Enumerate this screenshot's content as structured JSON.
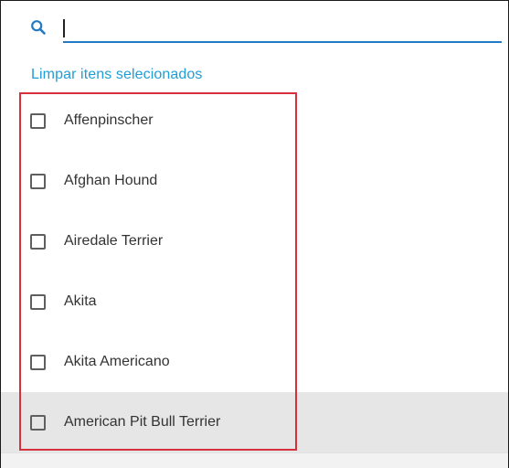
{
  "search": {
    "value": "",
    "placeholder": ""
  },
  "clear_selection_label": "Limpar itens selecionados",
  "items": [
    {
      "label": "Affenpinscher",
      "checked": false
    },
    {
      "label": "Afghan Hound",
      "checked": false
    },
    {
      "label": "Airedale Terrier",
      "checked": false
    },
    {
      "label": "Akita",
      "checked": false
    },
    {
      "label": "Akita Americano",
      "checked": false
    },
    {
      "label": "American Pit Bull Terrier",
      "checked": false,
      "hovered": true
    }
  ],
  "colors": {
    "accent": "#2479c4",
    "link": "#1f9dd6",
    "highlight_outline": "#d6303c",
    "hover_row": "#e6e6e6"
  },
  "icons": {
    "search": "search-icon"
  }
}
